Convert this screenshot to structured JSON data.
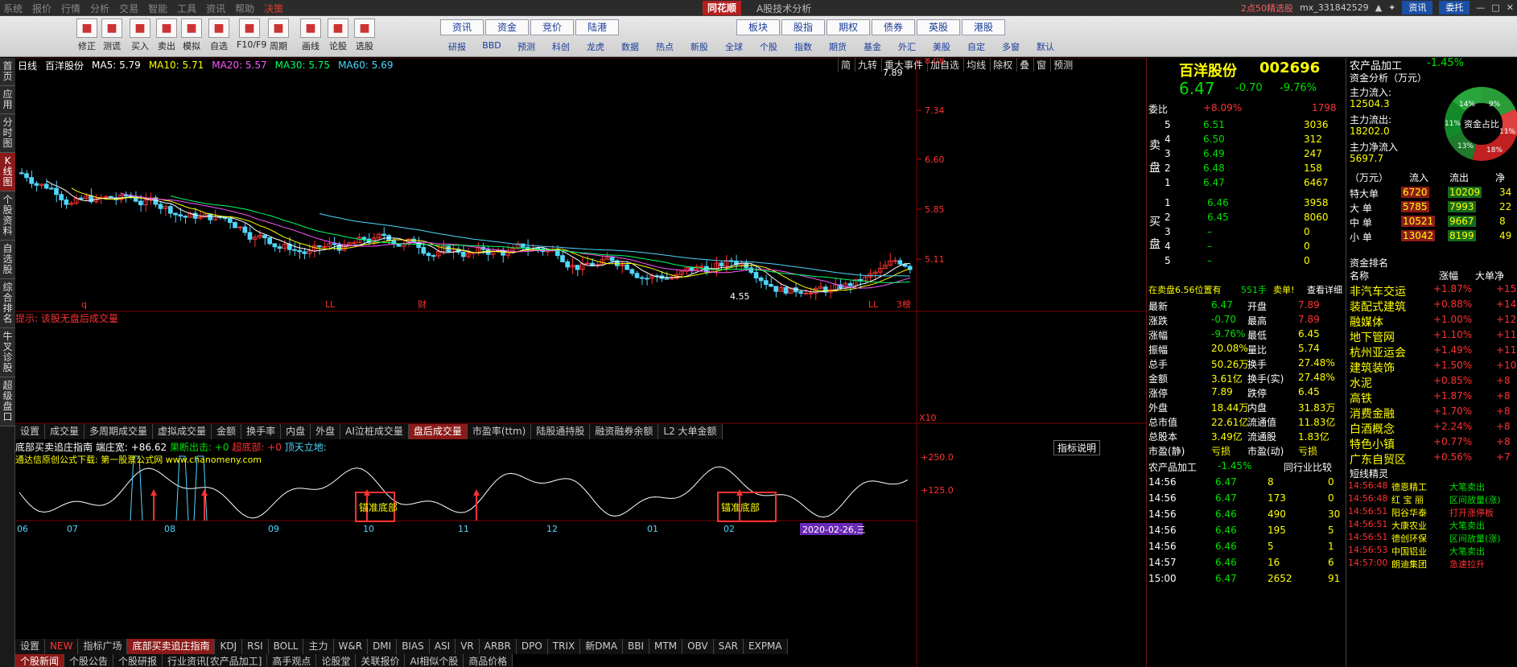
{
  "menu": [
    "系统",
    "报价",
    "行情",
    "分析",
    "交易",
    "智能",
    "工具",
    "资讯",
    "帮助",
    "决策"
  ],
  "brand": "同花顺",
  "app_title": "A股技术分析",
  "title_right": {
    "promo": "2点50精选股",
    "user": "mx_331842529",
    "info_btn": "资讯",
    "trade_btn": "委托"
  },
  "toolbar": {
    "big": [
      "修正",
      "测谎",
      "买入",
      "卖出",
      "模拟",
      "自选",
      "F10/F9",
      "周期",
      "画线",
      "论股",
      "选股"
    ],
    "small_top": [
      "资讯",
      "资金",
      "竞价",
      "陆港",
      "板块",
      "股指",
      "期权",
      "债券",
      "英股",
      "港股"
    ],
    "small_bottom": [
      "研报",
      "BBD",
      "预测",
      "科创",
      "龙虎",
      "数据",
      "热点",
      "新股",
      "全球",
      "个股",
      "指数",
      "期货",
      "基金",
      "外汇",
      "美股",
      "自定",
      "多窗",
      "默认"
    ]
  },
  "leftnav": [
    "首页",
    "应用",
    "分时图",
    "K线图",
    "个股资料",
    "自选股",
    "综合排名",
    "牛叉诊股",
    "超级盘口"
  ],
  "chart": {
    "period": "日线",
    "name": "百洋股份",
    "ma": [
      {
        "label": "MA5: 5.79",
        "color": "#ffffff"
      },
      {
        "label": "MA10: 5.71",
        "color": "#ffff00"
      },
      {
        "label": "MA20: 5.57",
        "color": "#ff55ff"
      },
      {
        "label": "MA30: 5.75",
        "color": "#00ff66"
      },
      {
        "label": "MA60: 5.69",
        "color": "#4fd7ff"
      }
    ],
    "tools": [
      "简",
      "九转",
      "重大事件",
      "加自选",
      "均线",
      "除权",
      "叠",
      "窗",
      "预测"
    ],
    "y_ticks": [
      "8.08",
      "7.34",
      "6.60",
      "5.85",
      "5.11"
    ],
    "high_label": "7.89",
    "low_label": "4.55",
    "markers": [
      "q",
      "LL",
      "财",
      "LL",
      "3榜"
    ],
    "x_months": [
      "06",
      "07",
      "08",
      "09",
      "10",
      "11",
      "12",
      "01",
      "02"
    ],
    "hint": "提示: 该股无盘后成交量",
    "vol_axis": "X10",
    "lower_tabs": [
      "设置",
      "成交量",
      "多周期成交量",
      "虚拟成交量",
      "金额",
      "换手率",
      "内盘",
      "外盘",
      "AI泣桩成交量",
      "盘后成交量",
      "市盈率(ttm)",
      "陆股通持股",
      "融资融券余额",
      "L2 大单金额"
    ],
    "indicator": {
      "title": "底部买卖追庄指南",
      "v1": "端庄宽: +86.62",
      "v2": "果断出击: +0",
      "v3": "超底部: +0",
      "v4": "顶天立地:",
      "explain_btn": "指标说明",
      "src": "通达信原创公式下载: 第一股票公式网 www.chanomeny.com",
      "y_top": "+250.0",
      "y_mid": "+125.0",
      "tag": "锚准底部",
      "date_tag": "2020-02-26,三"
    },
    "bottom_tabs": [
      "设置",
      "NEW",
      "指标广场",
      "底部买卖追庄指南",
      "KDJ",
      "RSI",
      "BOLL",
      "主力",
      "W&R",
      "DMI",
      "BIAS",
      "ASI",
      "VR",
      "ARBR",
      "DPO",
      "TRIX",
      "新DMA",
      "BBI",
      "MTM",
      "OBV",
      "SAR",
      "EXPMA"
    ],
    "news_tabs": [
      "个股新闻",
      "个股公告",
      "个股研报",
      "行业资讯[农产品加工]",
      "高手观点",
      "论股堂",
      "关联报价",
      "AI相似个股",
      "商品价格"
    ]
  },
  "quote": {
    "name": "百洋股份",
    "code": "002696",
    "price": "6.47",
    "change": "-0.70",
    "pct": "-9.76%",
    "weibi_label": "委比",
    "weibi": "+8.09%",
    "weicha": "1798",
    "sell_label": "卖盘",
    "buy_label": "买盘",
    "sells": [
      {
        "lv": "5",
        "p": "6.51",
        "v": "3036"
      },
      {
        "lv": "4",
        "p": "6.50",
        "v": "312"
      },
      {
        "lv": "3",
        "p": "6.49",
        "v": "247"
      },
      {
        "lv": "2",
        "p": "6.48",
        "v": "158"
      },
      {
        "lv": "1",
        "p": "6.47",
        "v": "6467"
      }
    ],
    "buys": [
      {
        "lv": "1",
        "p": "6.46",
        "v": "3958"
      },
      {
        "lv": "2",
        "p": "6.45",
        "v": "8060"
      },
      {
        "lv": "3",
        "p": "–",
        "v": "0"
      },
      {
        "lv": "4",
        "p": "–",
        "v": "0"
      },
      {
        "lv": "5",
        "p": "–",
        "v": "0"
      }
    ],
    "promo": "在卖盘6.56位置有",
    "promo_v": "551手",
    "promo_act": "卖单!",
    "promo_btn": "查看详细",
    "stats": [
      [
        "最新",
        "6.47",
        "开盘",
        "7.89"
      ],
      [
        "涨跌",
        "-0.70",
        "最高",
        "7.89"
      ],
      [
        "涨幅",
        "-9.76%",
        "最低",
        "6.45"
      ],
      [
        "振幅",
        "20.08%",
        "量比",
        "5.74"
      ],
      [
        "总手",
        "50.26万",
        "换手",
        "27.48%"
      ],
      [
        "金额",
        "3.61亿",
        "换手(实)",
        "27.48%"
      ],
      [
        "涨停",
        "7.89",
        "跌停",
        "6.45"
      ],
      [
        "外盘",
        "18.44万",
        "内盘",
        "31.83万"
      ],
      [
        "总市值",
        "22.61亿",
        "流通值",
        "11.83亿"
      ],
      [
        "总股本",
        "3.49亿",
        "流通股",
        "1.83亿"
      ],
      [
        "市盈(静)",
        "亏损",
        "市盈(动)",
        "亏损"
      ]
    ],
    "sector": "农产品加工",
    "sector_pct": "-1.45%",
    "sector_btn": "同行业比较",
    "ticks": [
      [
        "14:56",
        "6.47",
        "8",
        "0"
      ],
      [
        "14:56",
        "6.47",
        "173",
        "0"
      ],
      [
        "14:56",
        "6.46",
        "490",
        "30"
      ],
      [
        "14:56",
        "6.46",
        "195",
        "5"
      ],
      [
        "14:56",
        "6.46",
        "5",
        "1"
      ],
      [
        "14:57",
        "6.46",
        "16",
        "6"
      ],
      [
        "15:00",
        "6.47",
        "2652",
        "91"
      ]
    ]
  },
  "fund": {
    "sector_header": "农产品加工",
    "sector_pct": "-1.45%",
    "title": "资金分析（万元）",
    "in_label": "主力流入:",
    "in": "12504.3",
    "out_label": "主力流出:",
    "out": "18202.0",
    "net_label": "主力净流入",
    "net": "5697.7",
    "donut_center": "资金占比",
    "donut_pcts": [
      "14%",
      "9%",
      "11%",
      "18%",
      "13%",
      "11%"
    ],
    "table_head": [
      "（万元）",
      "流入",
      "流出",
      "净"
    ],
    "table": [
      [
        "特大单",
        "6720",
        "10209",
        "34"
      ],
      [
        "大 单",
        "5785",
        "7993",
        "22"
      ],
      [
        "中 单",
        "10521",
        "9667",
        "8"
      ],
      [
        "小 单",
        "13042",
        "8199",
        "49"
      ]
    ],
    "rank_title": "资金排名",
    "rank_head": [
      "名称",
      "涨幅",
      "大单净"
    ],
    "rank": [
      [
        "非汽车交运",
        "+1.87%",
        "+15"
      ],
      [
        "装配式建筑",
        "+0.88%",
        "+14"
      ],
      [
        "融媒体",
        "+1.00%",
        "+12"
      ],
      [
        "地下管网",
        "+1.10%",
        "+11"
      ],
      [
        "杭州亚运会",
        "+1.49%",
        "+11"
      ],
      [
        "建筑装饰",
        "+1.50%",
        "+10"
      ],
      [
        "水泥",
        "+0.85%",
        "+8"
      ],
      [
        "高铁",
        "+1.87%",
        "+8"
      ],
      [
        "消费金融",
        "+1.70%",
        "+8"
      ],
      [
        "白酒概念",
        "+2.24%",
        "+8"
      ],
      [
        "特色小镇",
        "+0.77%",
        "+8"
      ],
      [
        "广东自贸区",
        "+0.56%",
        "+7"
      ]
    ],
    "short_title": "短线精灵",
    "short": [
      [
        "14:56:48",
        "德恩精工",
        "大笔卖出"
      ],
      [
        "14:56:48",
        "红 宝 丽",
        "区间放量(涨)"
      ],
      [
        "14:56:51",
        "阳谷华泰",
        "打开涨停板"
      ],
      [
        "14:56:51",
        "大康农业",
        "大笔卖出"
      ],
      [
        "14:56:51",
        "德创环保",
        "区间放量(涨)"
      ],
      [
        "14:56:53",
        "中国铝业",
        "大笔卖出"
      ],
      [
        "14:57:00",
        "朗迪集团",
        "急速拉升"
      ]
    ]
  }
}
